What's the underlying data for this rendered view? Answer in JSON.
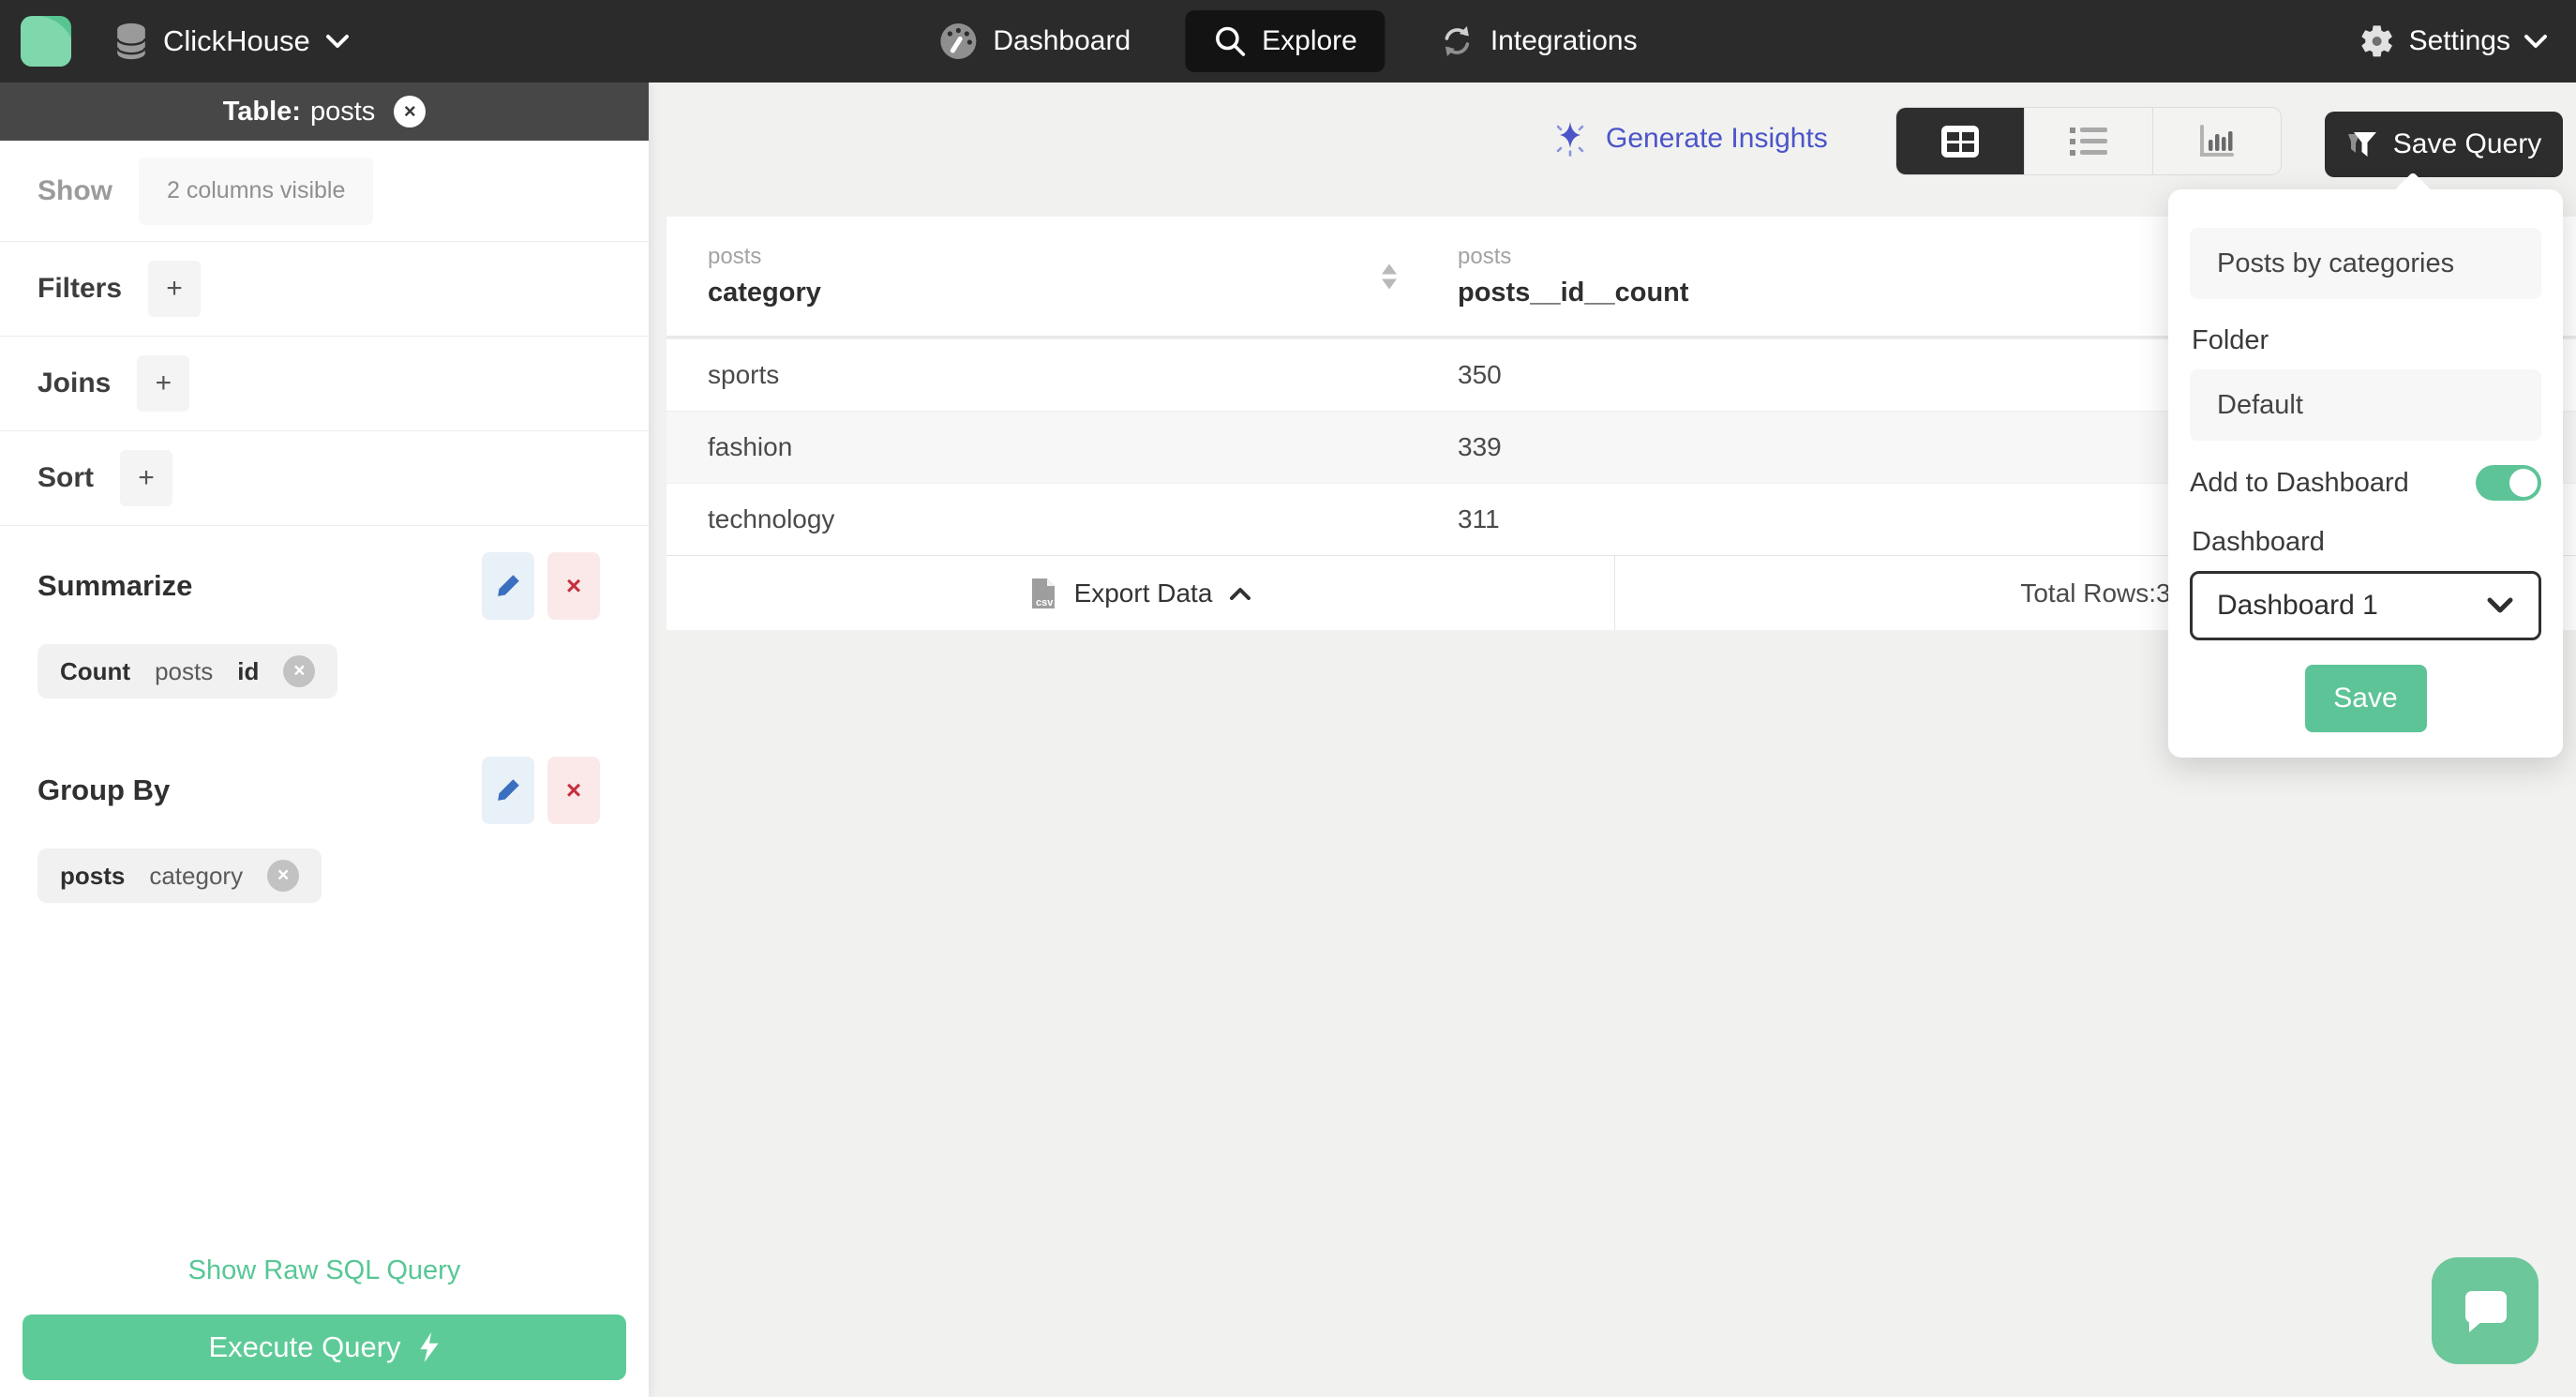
{
  "colors": {
    "topnav_bg": "#2b2b2b",
    "active_pill_bg": "#131313",
    "sidebar_header_bg": "#474747",
    "green": "#5dcb98",
    "indigo": "#4b55c8",
    "danger_red": "#c5303c",
    "edit_blue": "#3a6fc0",
    "main_bg": "#f1f1f0",
    "row_stripe": "#f7f7f7"
  },
  "topnav": {
    "brand": "ClickHouse",
    "items": [
      {
        "label": "Dashboard"
      },
      {
        "label": "Explore",
        "active": true
      },
      {
        "label": "Integrations"
      }
    ],
    "settings_label": "Settings"
  },
  "sidebar": {
    "table_header": {
      "prefix": "Table:",
      "name": "posts"
    },
    "show": {
      "label": "Show",
      "chip": "2 columns visible"
    },
    "filters": {
      "label": "Filters",
      "add": "+"
    },
    "joins": {
      "label": "Joins",
      "add": "+"
    },
    "sort": {
      "label": "Sort",
      "add": "+"
    },
    "summarize": {
      "label": "Summarize",
      "chip": {
        "agg": "Count",
        "table": "posts",
        "column": "id"
      }
    },
    "group_by": {
      "label": "Group By",
      "chip": {
        "table": "posts",
        "column": "category"
      }
    },
    "raw_sql_link": "Show Raw SQL Query",
    "execute_button": "Execute Query"
  },
  "toolbar": {
    "generate_insights": "Generate Insights",
    "save_query": "Save Query"
  },
  "table": {
    "columns": [
      {
        "group": "posts",
        "name": "category"
      },
      {
        "group": "posts",
        "name": "posts__id__count"
      }
    ],
    "rows": [
      {
        "category": "sports",
        "count": "350"
      },
      {
        "category": "fashion",
        "count": "339"
      },
      {
        "category": "technology",
        "count": "311"
      }
    ],
    "footer": {
      "export_label": "Export Data",
      "total_label": "Total Rows:3"
    }
  },
  "popover": {
    "name_value": "Posts by categories",
    "folder_label": "Folder",
    "folder_value": "Default",
    "add_to_dashboard_label": "Add to Dashboard",
    "dashboard_label": "Dashboard",
    "dashboard_value": "Dashboard 1",
    "save_button": "Save"
  }
}
